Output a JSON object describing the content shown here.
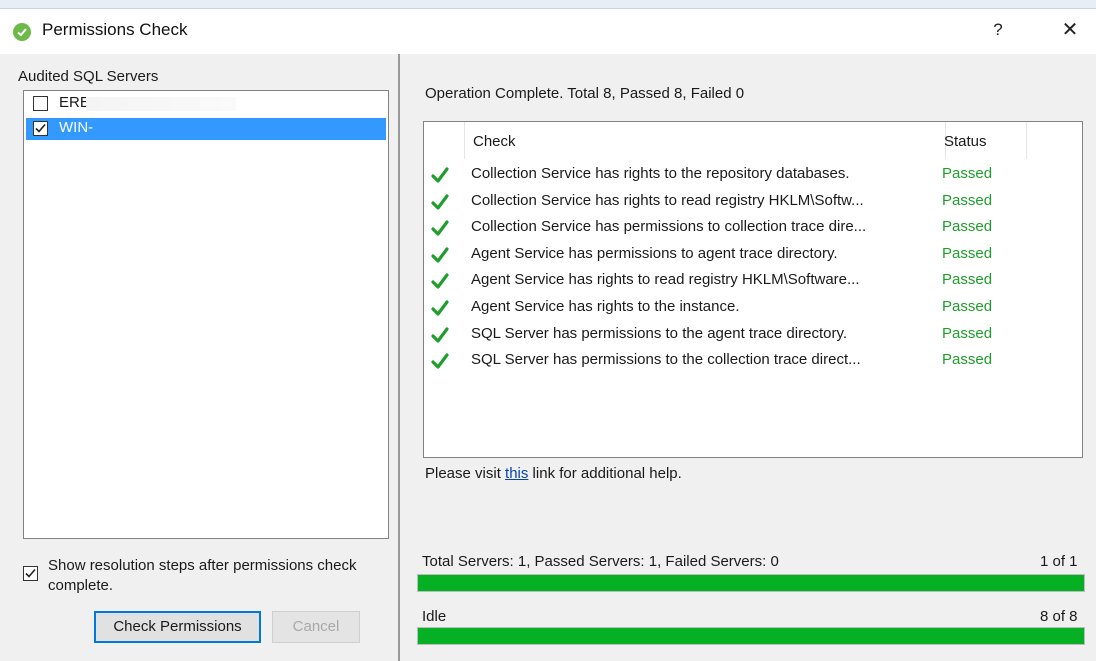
{
  "window": {
    "title": "Permissions Check",
    "help_label": "?",
    "close_label": "✕"
  },
  "left": {
    "audited_label": "Audited SQL Servers",
    "servers": [
      {
        "name": "ERE",
        "checked": false,
        "selected": false
      },
      {
        "name": "WIN-",
        "checked": true,
        "selected": true
      }
    ],
    "resolution_label": "Show resolution steps after permissions check complete.",
    "resolution_checked": true,
    "check_button": "Check Permissions",
    "cancel_button": "Cancel"
  },
  "right": {
    "status_line": "Operation Complete. Total 8, Passed 8, Failed 0",
    "columns": {
      "check": "Check",
      "status": "Status"
    },
    "rows": [
      {
        "check": "Collection Service has rights to the repository databases.",
        "status": "Passed"
      },
      {
        "check": "Collection Service has rights to read registry HKLM\\Softw...",
        "status": "Passed"
      },
      {
        "check": "Collection Service has permissions to collection trace dire...",
        "status": "Passed"
      },
      {
        "check": "Agent Service has permissions to agent trace directory.",
        "status": "Passed"
      },
      {
        "check": "Agent Service has rights to read registry HKLM\\Software...",
        "status": "Passed"
      },
      {
        "check": "Agent Service has rights to the instance.",
        "status": "Passed"
      },
      {
        "check": "SQL Server has permissions to the agent trace directory.",
        "status": "Passed"
      },
      {
        "check": "SQL Server has permissions to the collection trace direct...",
        "status": "Passed"
      }
    ],
    "help": {
      "prefix": "Please visit ",
      "link": "this",
      "suffix": " link for additional help."
    },
    "servers_summary": "Total Servers: 1, Passed Servers: 1, Failed Servers: 0",
    "servers_count": "1 of 1",
    "servers_progress": 1.0,
    "idle_label": "Idle",
    "idle_count": "8 of 8",
    "idle_progress": 1.0
  },
  "colors": {
    "passed": "#1e9e2a",
    "progress": "#06b025",
    "selection": "#3399ff"
  },
  "icons": {
    "app": "green-check-circle-icon",
    "row": "green-checkmark-icon"
  }
}
